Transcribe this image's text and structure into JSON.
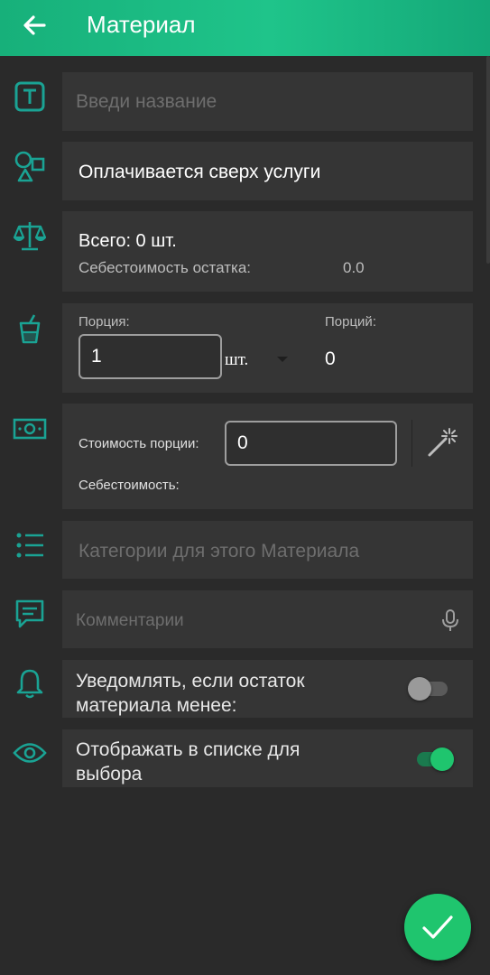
{
  "appbar": {
    "title": "Материал"
  },
  "name_field": {
    "placeholder": "Введи название"
  },
  "type_field": {
    "value": "Оплачивается сверх услуги"
  },
  "stock": {
    "total": "Всего: 0 шт.",
    "cost_label": "Себестоимость остатка:",
    "cost_value": "0.0"
  },
  "portion": {
    "label": "Порция:",
    "value": "1",
    "unit": "шт.",
    "portions_label": "Порций:",
    "portions_value": "0"
  },
  "price": {
    "label": "Стоимость порции:",
    "value": "0",
    "cost_label": "Себестоимость:"
  },
  "categories": {
    "placeholder": "Категории для этого Материала"
  },
  "comments": {
    "placeholder": "Комментарии"
  },
  "notify": {
    "label": "Уведомлять, если остаток материала менее:",
    "enabled": false
  },
  "show_in_list": {
    "label": "Отображать в списке для выбора",
    "enabled": true
  },
  "colors": {
    "accent": "#1fc56e",
    "icon_teal": "#1aa394",
    "appbar": "#1cb882",
    "background": "#2a2a2a",
    "card": "#353535"
  },
  "icons": [
    "back-arrow-icon",
    "text-icon",
    "shapes-icon",
    "scales-icon",
    "cup-icon",
    "money-icon",
    "list-icon",
    "comment-icon",
    "microphone-icon",
    "bell-icon",
    "eye-icon",
    "magic-wand-icon",
    "dropdown-arrow-icon",
    "check-icon"
  ]
}
